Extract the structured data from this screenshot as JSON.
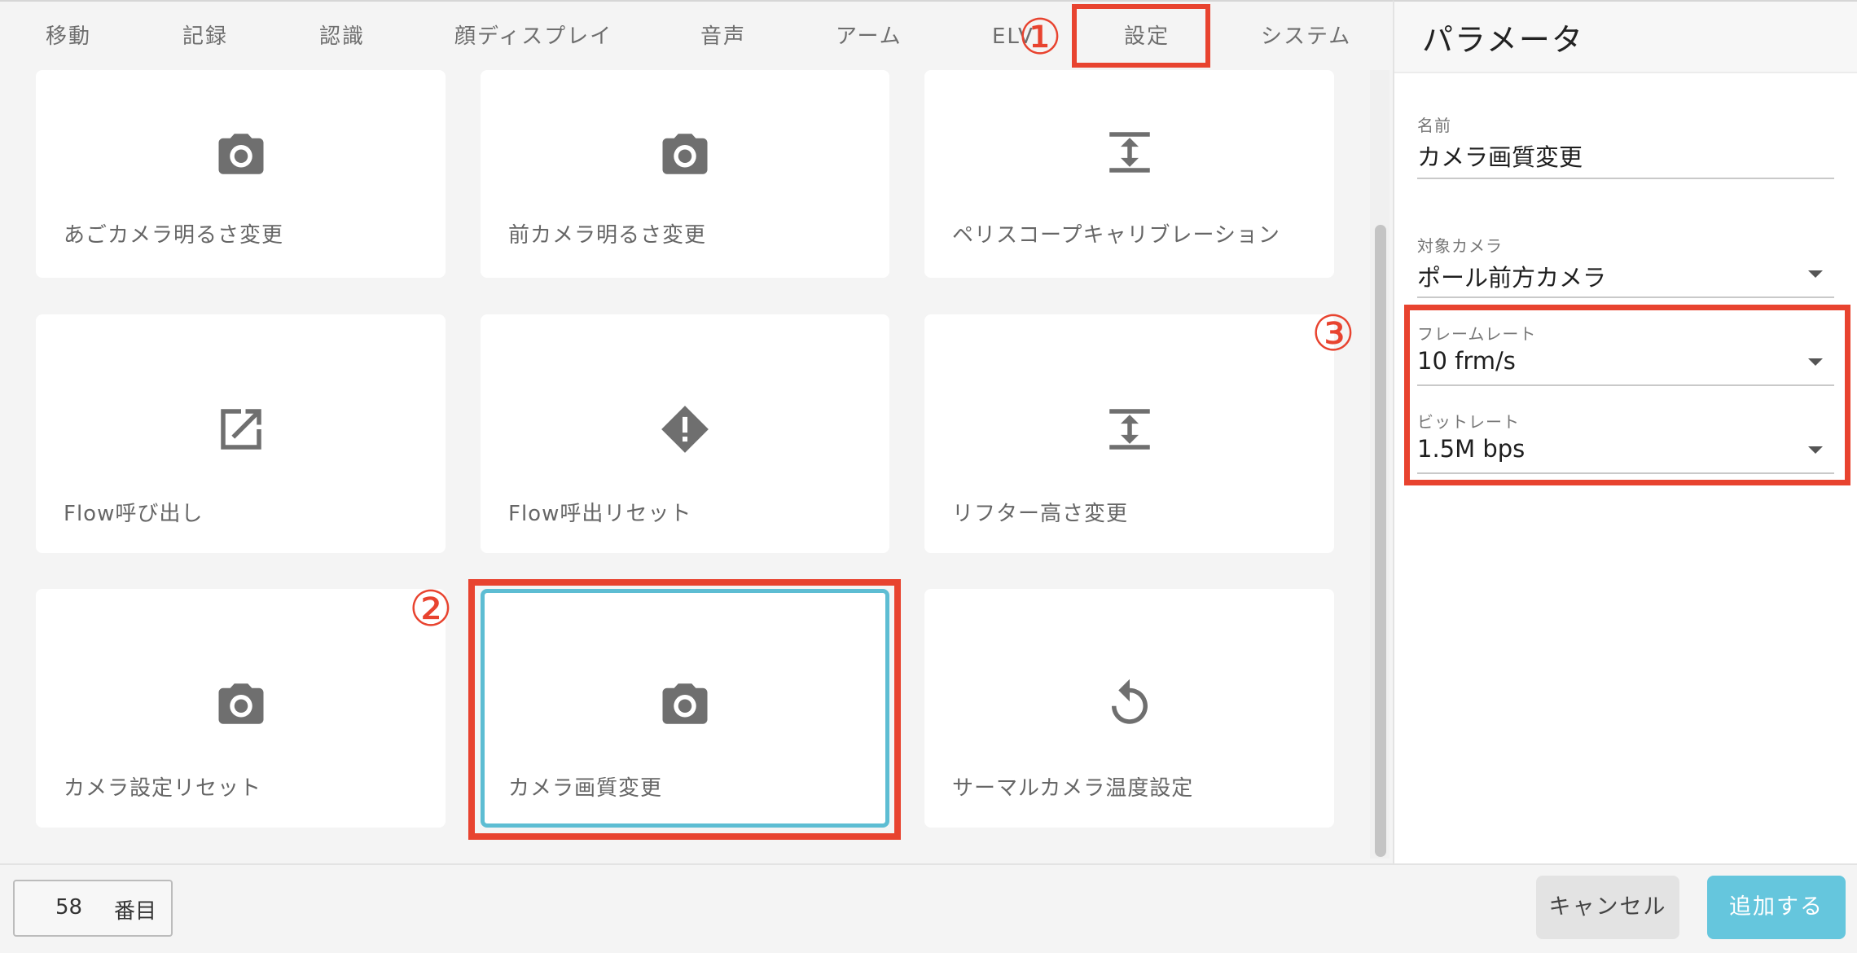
{
  "tabs": [
    {
      "label": "移動"
    },
    {
      "label": "記録"
    },
    {
      "label": "認識"
    },
    {
      "label": "顔ディスプレイ"
    },
    {
      "label": "音声"
    },
    {
      "label": "アーム"
    },
    {
      "label": "ELV"
    },
    {
      "label": "設定"
    },
    {
      "label": "システム"
    }
  ],
  "annotations": {
    "one": "①",
    "two": "②",
    "three": "③"
  },
  "cards": [
    {
      "label": "あごカメラ明るさ変更",
      "icon": "camera-icon"
    },
    {
      "label": "前カメラ明るさ変更",
      "icon": "camera-icon"
    },
    {
      "label": "ペリスコープキャリブレーション",
      "icon": "vertical-align-icon"
    },
    {
      "label": "Flow呼び出し",
      "icon": "open-in-new-icon"
    },
    {
      "label": "Flow呼出リセット",
      "icon": "warning-diamond-icon"
    },
    {
      "label": "リフター高さ変更",
      "icon": "vertical-align-icon"
    },
    {
      "label": "カメラ設定リセット",
      "icon": "camera-icon"
    },
    {
      "label": "カメラ画質変更",
      "icon": "camera-icon"
    },
    {
      "label": "サーマルカメラ温度設定",
      "icon": "rotate-icon"
    }
  ],
  "panel": {
    "title": "パラメータ",
    "name_label": "名前",
    "name_value": "カメラ画質変更",
    "camera_label": "対象カメラ",
    "camera_value": "ポール前方カメラ",
    "framerate_label": "フレームレート",
    "framerate_value": "10 frm/s",
    "bitrate_label": "ビットレート",
    "bitrate_value": "1.5M bps"
  },
  "footer": {
    "index_value": "58",
    "index_unit": "番目",
    "cancel_label": "キャンセル",
    "add_label": "追加する"
  },
  "colors": {
    "accent": "#65c6dd",
    "highlight": "#e8432f",
    "icon": "#6f6f6f"
  }
}
